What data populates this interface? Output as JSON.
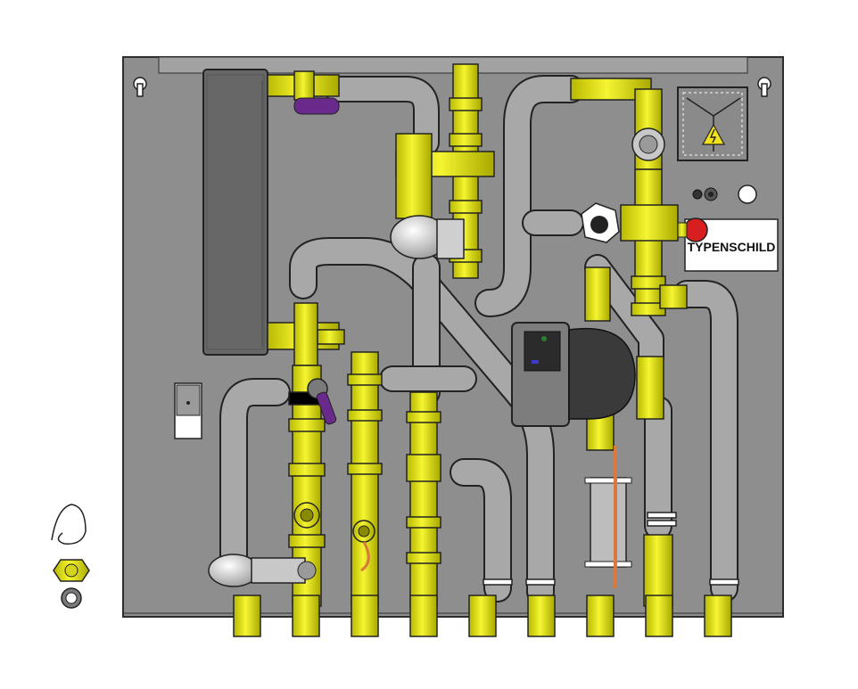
{
  "nameplate": {
    "label": "TYPENSCHILD"
  },
  "colors": {
    "panel": "#8c8c8c",
    "panel_edge": "#3a3a3a",
    "pipe_grey": "#a5a5a5",
    "pipe_dark": "#6e6e6e",
    "brass_yellow": "#e6e619",
    "brass_dark": "#9a9a10",
    "heat_exchanger": "#6a6a6a",
    "valve_red": "#d81e1e",
    "copper": "#d87a3c",
    "purple_handle": "#6a2a8c"
  },
  "icons": [
    "keyhole-mount-icon",
    "electrical-hazard-icon",
    "pump-icon",
    "thermometer-icon",
    "ball-valve-icon",
    "safety-valve-icon",
    "thermostatic-head-icon"
  ]
}
